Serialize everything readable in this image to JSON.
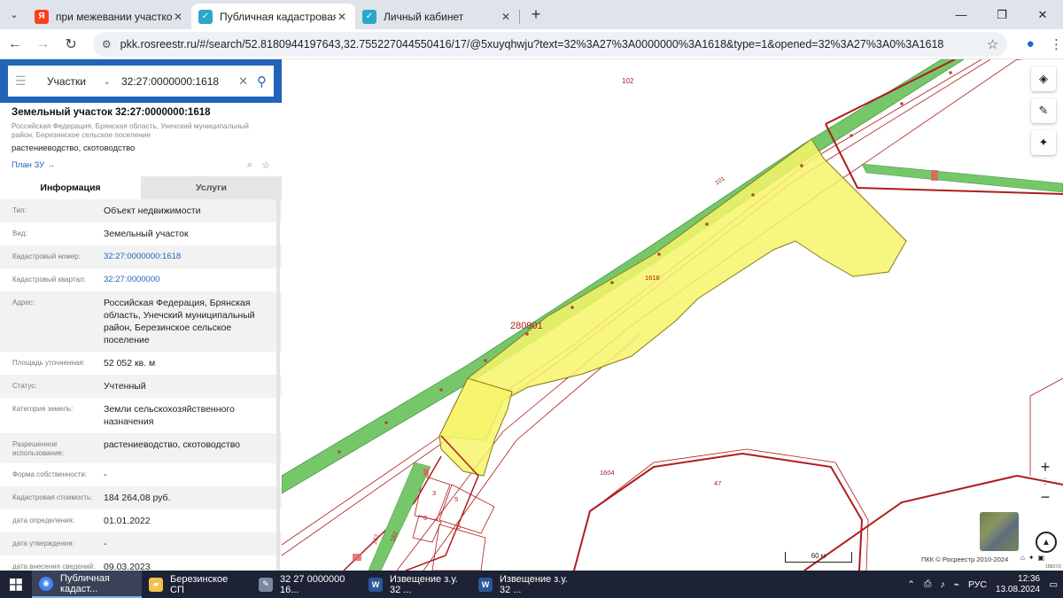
{
  "browser": {
    "tabs": [
      {
        "title": "при межевании участков не д",
        "favicon": "yandex-icon",
        "color": "#fc3f1d",
        "glyph": "Я"
      },
      {
        "title": "Публичная кадастровая карта",
        "favicon": "rosreestr-icon",
        "color": "#2aa7c9",
        "glyph": "✓"
      },
      {
        "title": "Личный кабинет",
        "favicon": "rosreestr-icon",
        "color": "#2aa7c9",
        "glyph": "✓"
      }
    ],
    "new_tab": "+",
    "url": "pkk.rosreestr.ru/#/search/52.8180944197643,32.755227044550416/17/@5xuyqhwju?text=32%3A27%3A0000000%3A1618&type=1&opened=32%3A27%3A0%3A1618"
  },
  "search": {
    "type_label": "Участки",
    "query": "32:27:0000000:1618"
  },
  "object": {
    "title": "Земельный участок 32:27:0000000:1618",
    "address_short": "Российская Федерация, Брянская область, Унечский муниципальный район, Березинское сельское поселение",
    "use": "растениеводство, скотоводство",
    "plan_link": "План ЗУ →"
  },
  "subtabs": {
    "info": "Информация",
    "services": "Услуги"
  },
  "properties": [
    {
      "k": "Тип:",
      "v": "Объект недвижимости",
      "link": false
    },
    {
      "k": "Вид:",
      "v": "Земельный участок",
      "link": false
    },
    {
      "k": "Кадастровый номер:",
      "v": "32:27:0000000:1618",
      "link": true
    },
    {
      "k": "Кадастровый квартал:",
      "v": "32:27:0000000",
      "link": true
    },
    {
      "k": "Адрес:",
      "v": "Российская Федерация, Брянская область, Унечский муниципальный район, Березинское сельское поселение",
      "link": false
    },
    {
      "k": "Площадь уточненная:",
      "v": "52 052 кв. м",
      "link": false
    },
    {
      "k": "Статус:",
      "v": "Учтенный",
      "link": false
    },
    {
      "k": "Категория земель:",
      "v": "Земли сельскохозяйственного назначения",
      "link": false
    },
    {
      "k": "Разрешенное использование:",
      "v": "растениеводство, скотоводство",
      "link": false
    },
    {
      "k": "Форма собственности:",
      "v": "-",
      "link": false
    },
    {
      "k": "Кадастровая стоимость:",
      "v": "184 264,08 руб.",
      "link": false
    },
    {
      "k": "дата определения:",
      "v": "01.01.2022",
      "link": false
    },
    {
      "k": "дата утверждения:",
      "v": "-",
      "link": false
    },
    {
      "k": "дата внесения сведений:",
      "v": "09.03.2023",
      "link": false
    }
  ],
  "map": {
    "labels": {
      "l102": "102",
      "l101": "101",
      "l1618": "1618",
      "l280901": "280901",
      "l1604": "1604",
      "l47": "47",
      "l3a": "3",
      "l3b": "3",
      "l5a": "5",
      "l5b": "5",
      "l162": "162",
      "l162b": "162"
    },
    "scale": "60 м",
    "copyright": "ПКК © Росреестр 2010-2024",
    "corner": "15837/2",
    "colors": {
      "parcel_fill": "#f6f46a",
      "road": "#76c76a",
      "boundary_red": "#b01c1c"
    }
  },
  "taskbar": {
    "items": [
      {
        "label": "Публичная кадаст...",
        "icon": "chrome-icon",
        "color": "#4285f4",
        "glyph": "◉",
        "active": true
      },
      {
        "label": "Березинское СП",
        "icon": "folder-icon",
        "color": "#f2c24b",
        "glyph": "▰",
        "active": false
      },
      {
        "label": "32  27  0000000  16...",
        "icon": "paint-icon",
        "color": "#7a8aa0",
        "glyph": "✎",
        "active": false
      },
      {
        "label": "Извещение з.у. 32 ...",
        "icon": "word-icon",
        "color": "#2b579a",
        "glyph": "W",
        "active": false
      },
      {
        "label": "Извещение з.у. 32 ...",
        "icon": "word-icon",
        "color": "#2b579a",
        "glyph": "W",
        "active": false
      }
    ],
    "lang": "РУС",
    "time": "12:36",
    "date": "13.08.2024"
  }
}
